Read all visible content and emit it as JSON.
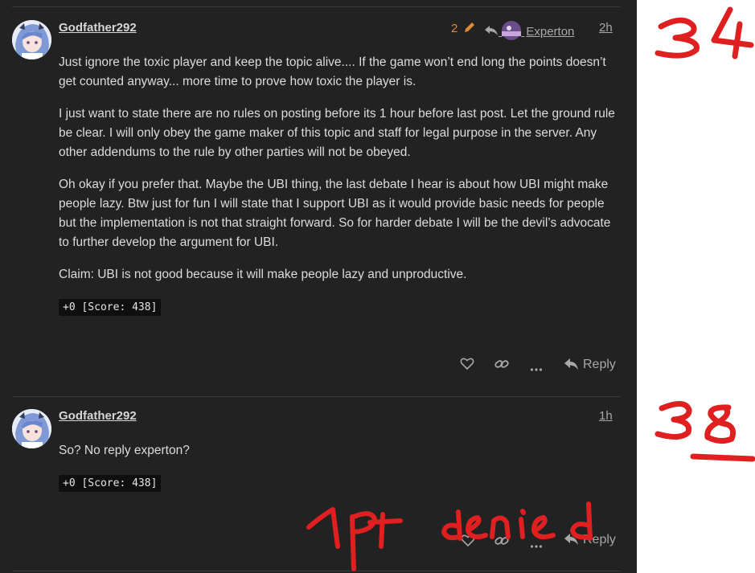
{
  "posts": [
    {
      "username": "Godfather292",
      "edit_count": "2",
      "reply_to_user": "Experton",
      "time": "2h",
      "paragraphs": [
        "Just ignore the toxic player and keep the topic alive.... If the game won’t end long the points doesn’t get counted anyway... more time to prove how toxic the player is.",
        "I just want to state there are no rules on posting before its 1 hour before last post. Let the ground rule be clear. I will only obey the game maker of this topic and staff for legal purpose in the server. Any other addendums to the rule by other parties will not be obeyed.",
        "Oh okay if you prefer that. Maybe the UBI thing, the last debate I hear is about how UBI might make people lazy. Btw just for fun I will state that I support UBI as it would provide basic needs for people but the implementation is not that straight forward. So for harder debate I will be the devil’s advocate to further develop the argument for UBI.",
        "Claim: UBI is not good because it will make people lazy and unproductive."
      ],
      "score": "+0 [Score: 438]",
      "reply_label": "Reply"
    },
    {
      "username": "Godfather292",
      "time": "1h",
      "paragraphs": [
        "So? No reply experton?"
      ],
      "score": "+0 [Score: 438]",
      "reply_label": "Reply"
    }
  ],
  "annotations": {
    "post1_number": "34",
    "post2_number": "38",
    "overlay_text": "1pt denied",
    "ink_color": "#e02020"
  },
  "icons": [
    "pencil-icon",
    "reply-arrow-icon",
    "heart-icon",
    "link-icon",
    "more-icon",
    "reply-icon"
  ]
}
